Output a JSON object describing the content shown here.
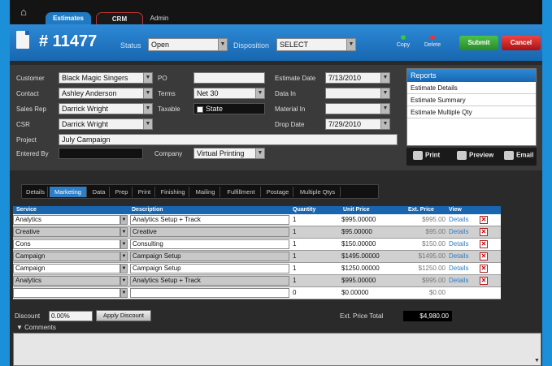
{
  "nav": {
    "tabs": [
      "Estimates",
      "CRM",
      "Admin"
    ]
  },
  "header": {
    "estimate_number": "# 11477",
    "status_label": "Status",
    "status_value": "Open",
    "disposition_label": "Disposition",
    "disposition_value": "SELECT",
    "copy_label": "Copy",
    "delete_label": "Delete",
    "submit_label": "Submit",
    "cancel_label": "Cancel"
  },
  "form": {
    "customer_label": "Customer",
    "customer_value": "Black Magic Singers",
    "contact_label": "Contact",
    "contact_value": "Ashley Anderson",
    "salesrep_label": "Sales Rep",
    "salesrep_value": "Darrick Wright",
    "csr_label": "CSR",
    "csr_value": "Darrick Wright",
    "project_label": "Project",
    "project_value": "July Campaign",
    "enteredby_label": "Entered By",
    "enteredby_value": "",
    "po_label": "PO",
    "po_value": "",
    "terms_label": "Terms",
    "terms_value": "Net 30",
    "taxable_label": "Taxable",
    "taxable_value": "State",
    "company_label": "Company",
    "company_value": "Virtual Printing",
    "estimatedate_label": "Estimate Date",
    "estimatedate_value": "7/13/2010",
    "datain_label": "Data In",
    "datain_value": "",
    "materialin_label": "Material In",
    "materialin_value": "",
    "dropdate_label": "Drop Date",
    "dropdate_value": "7/29/2010"
  },
  "reports": {
    "title": "Reports",
    "items": [
      "Estimate Details",
      "Estimate Summary",
      "Estimate Multiple Qty"
    ],
    "print_label": "Print",
    "preview_label": "Preview",
    "email_label": "Email"
  },
  "subtabs": [
    "Details",
    "Marketing",
    "Data",
    "Prep",
    "Print",
    "Finishing",
    "Mailing",
    "Fulfillment",
    "Postage",
    "Multiple Qtys"
  ],
  "table": {
    "headers": [
      "Service",
      "Description",
      "Quantity",
      "Unit Price",
      "Ext. Price",
      "View"
    ],
    "rows": [
      {
        "service": "Analytics",
        "description": "Analytics Setup + Track",
        "quantity": "1",
        "unit_price": "$995.00000",
        "ext_price": "$995.00",
        "view": "Details"
      },
      {
        "service": "Creative",
        "description": "Creative",
        "quantity": "1",
        "unit_price": "$95.00000",
        "ext_price": "$95.00",
        "view": "Details"
      },
      {
        "service": "Cons",
        "description": "Consulting",
        "quantity": "1",
        "unit_price": "$150.00000",
        "ext_price": "$150.00",
        "view": "Details"
      },
      {
        "service": "Campaign",
        "description": "Campaign Setup",
        "quantity": "1",
        "unit_price": "$1495.00000",
        "ext_price": "$1495.00",
        "view": "Details"
      },
      {
        "service": "Campaign",
        "description": "Campaign Setup",
        "quantity": "1",
        "unit_price": "$1250.00000",
        "ext_price": "$1250.00",
        "view": "Details"
      },
      {
        "service": "Analytics",
        "description": "Analytics Setup + Track",
        "quantity": "1",
        "unit_price": "$995.00000",
        "ext_price": "$995.00",
        "view": "Details"
      },
      {
        "service": "",
        "description": "",
        "quantity": "0",
        "unit_price": "$0.00000",
        "ext_price": "$0.00",
        "view": ""
      }
    ]
  },
  "footer": {
    "discount_label": "Discount",
    "discount_value": "0.00%",
    "apply_label": "Apply Discount",
    "ext_total_label": "Ext. Price Total",
    "ext_total_value": "$4,980.00",
    "comments_label": "Comments"
  }
}
